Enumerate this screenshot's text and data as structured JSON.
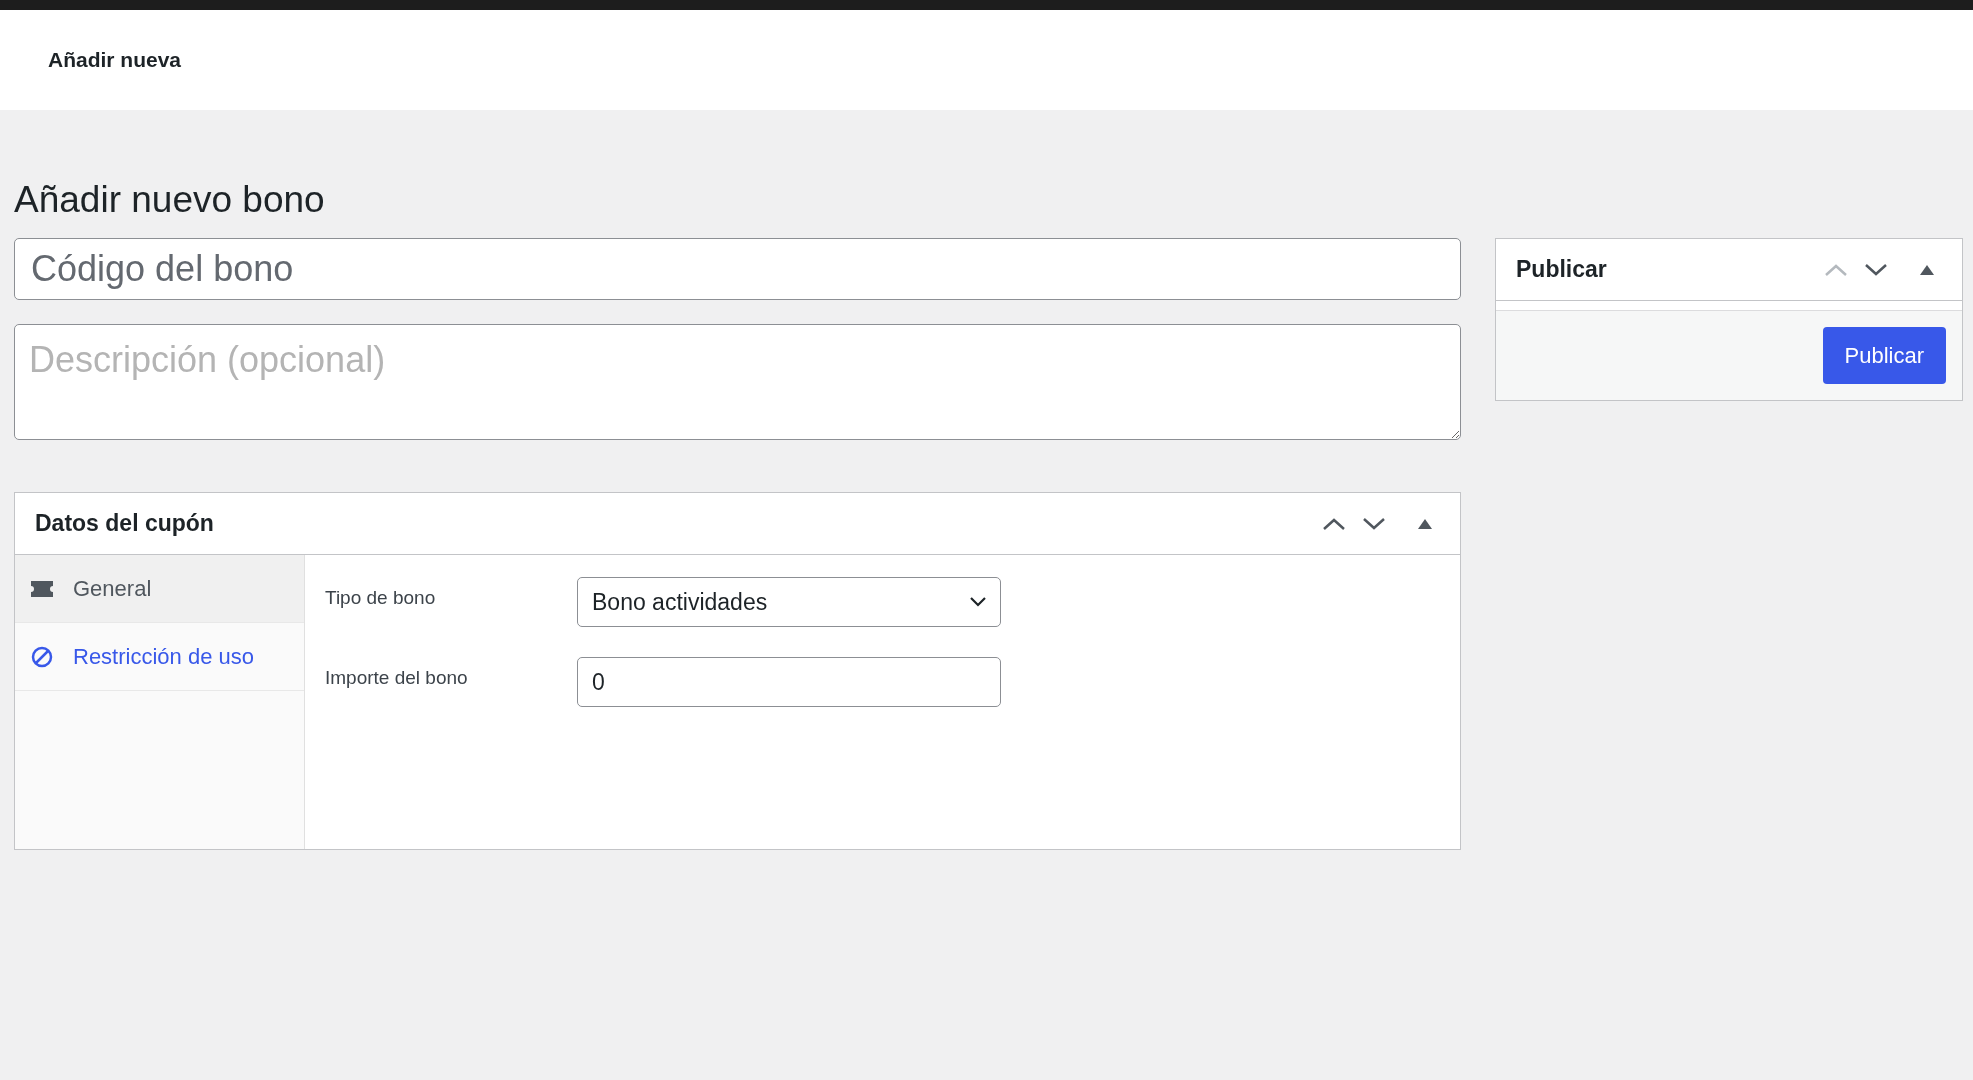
{
  "top_bar": {
    "title": "Añadir nueva"
  },
  "page_title": "Añadir nuevo bono",
  "code_field": {
    "placeholder": "Código del bono"
  },
  "description_field": {
    "placeholder": "Descripción (opcional)"
  },
  "coupon_box": {
    "title": "Datos del cupón",
    "move_up_disabled": false,
    "tabs": [
      {
        "label": "General",
        "kind": "ticket",
        "selected": true
      },
      {
        "label": "Restricción de uso",
        "kind": "block",
        "selected": false
      }
    ],
    "fields": [
      {
        "label": "Tipo de bono",
        "kind": "select",
        "value": "Bono actividades"
      },
      {
        "label": "Importe del bono",
        "kind": "input",
        "value": "0"
      }
    ]
  },
  "publish_box": {
    "title": "Publicar",
    "move_up_disabled": true,
    "button": "Publicar"
  }
}
